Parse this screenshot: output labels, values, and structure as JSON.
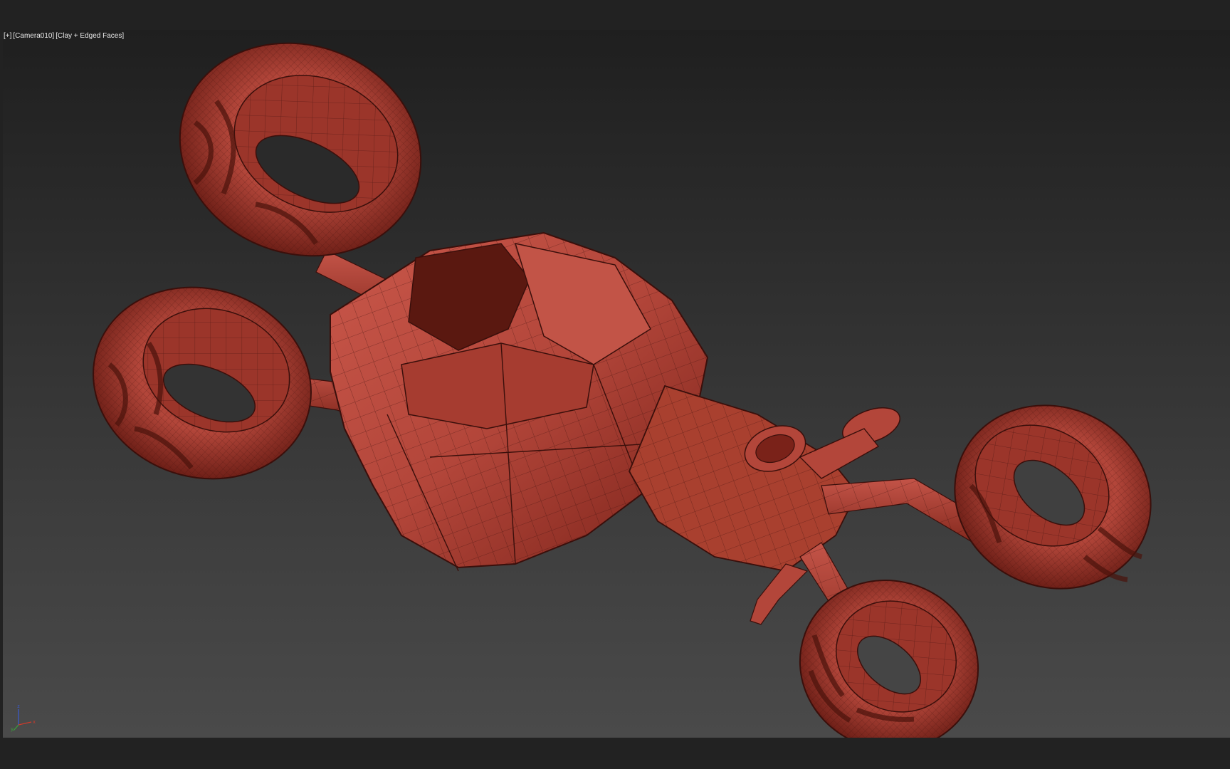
{
  "viewport": {
    "label_plus": "[+]",
    "label_camera": "[Camera010]",
    "label_shading": "[Clay + Edged Faces]"
  },
  "scene": {
    "model": "hover-bike-wireframe",
    "material_color": "#b3463a",
    "edge_color": "#3a0f0b"
  },
  "axis_tripod": {
    "x_label": "x",
    "y_label": "y",
    "z_label": "z",
    "x_color": "#d03a2a",
    "y_color": "#3aa23a",
    "z_color": "#3a5ad0"
  },
  "colors": {
    "background": "#222222",
    "viewport_top": "#1f1f1f",
    "viewport_bottom": "#4a4a4a"
  }
}
